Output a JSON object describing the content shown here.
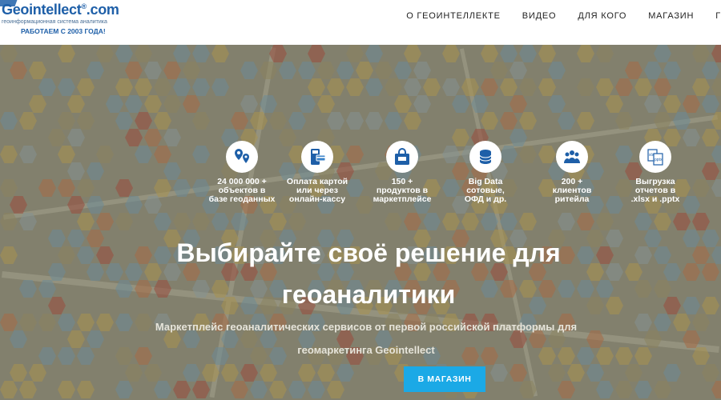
{
  "header": {
    "logo": {
      "name": "Geointellect",
      "mark": "®",
      "suffix": ".com",
      "subtitle": "геоинформационная система аналитика",
      "tagline": "РАБОТАЕМ С 2003 ГОДА!"
    },
    "nav": [
      {
        "label": "О ГЕОИНТЕЛЛЕКТЕ"
      },
      {
        "label": "ВИДЕО"
      },
      {
        "label": "ДЛЯ КОГО"
      },
      {
        "label": "МАГАЗИН"
      },
      {
        "label": "Г"
      }
    ]
  },
  "hero": {
    "features": [
      {
        "icon": "map-pin-icon",
        "text": "24 000 000 +\nобъектов в\nбазе геоданных"
      },
      {
        "icon": "card-payment-icon",
        "text": "Оплата картой\nили через\nонлайн-кассу"
      },
      {
        "icon": "shopping-bag-icon",
        "text": "150 +\nпродуктов в\nмаркетплейсе"
      },
      {
        "icon": "database-icon",
        "text": "Big Data\nсотовые,\nОФД и др."
      },
      {
        "icon": "clients-icon",
        "text": "200 +\nклиентов\nритейла"
      },
      {
        "icon": "export-files-icon",
        "text": "Выгрузка\nотчетов в\n.xlsx и .pptx"
      }
    ],
    "title_line1": "Выбирайте своё решение для",
    "title_line2": "геоаналитики",
    "subtitle_line1": "Маркетплейс геоаналитических сервисов от первой российской платформы для",
    "subtitle_line2": "геомаркетинга Geointellect",
    "cta_label": "В МАГАЗИН"
  },
  "colors": {
    "brand": "#1e5fa8",
    "cta": "#1ba9e6",
    "hex_palette": [
      "#6b9bb8",
      "#c9a84a",
      "#c56a3a",
      "#9a8f63",
      "#b03a2e",
      "#8fa6b0"
    ]
  }
}
